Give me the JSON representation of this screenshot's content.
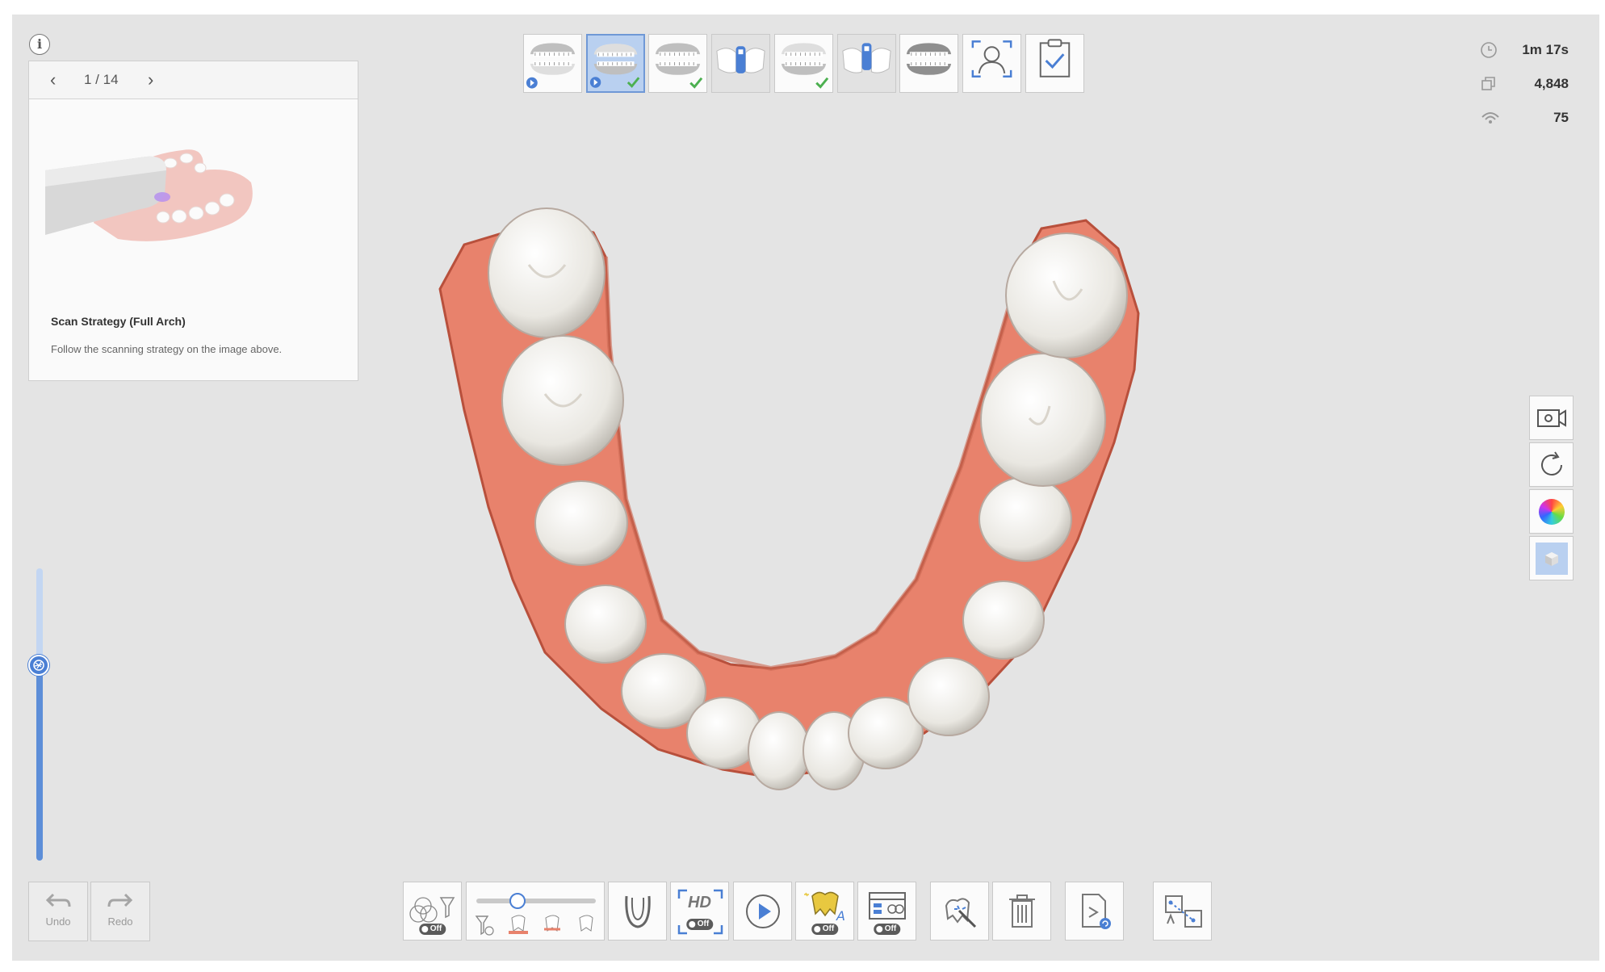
{
  "info_panel": {
    "pager": "1 / 14",
    "title": "Scan Strategy (Full Arch)",
    "description": "Follow the scanning strategy on the image above."
  },
  "stats": {
    "time": "1m 17s",
    "frames": "4,848",
    "accuracy": "75"
  },
  "history": {
    "undo_label": "Undo",
    "redo_label": "Redo"
  },
  "scan_stages": [
    {
      "name": "Maxilla",
      "state": "default"
    },
    {
      "name": "Mandible",
      "state": "active-done"
    },
    {
      "name": "Occlusion",
      "state": "done"
    },
    {
      "name": "Maxilla Scan Body",
      "state": "dim"
    },
    {
      "name": "Mandible Pre-op",
      "state": "done"
    },
    {
      "name": "Mandible Scan Body",
      "state": "dim"
    },
    {
      "name": "Occlusion Pre-op",
      "state": "default"
    },
    {
      "name": "Face Scan",
      "state": "default"
    },
    {
      "name": "Review",
      "state": "default"
    }
  ],
  "bottom_toolbar": {
    "filter_toggle": "Off",
    "hd_label": "HD",
    "hd_toggle": "Off",
    "ai_toggle": "Off",
    "smart_toggle": "Off",
    "slider_position": 0.35
  },
  "scan_depth_slider": {
    "value": 0.67
  },
  "colors": {
    "gum": "#e8826c",
    "tooth": "#ecebe6",
    "accent": "#4a7fd4",
    "active": "#b9d0f0",
    "check": "#4cb050"
  }
}
